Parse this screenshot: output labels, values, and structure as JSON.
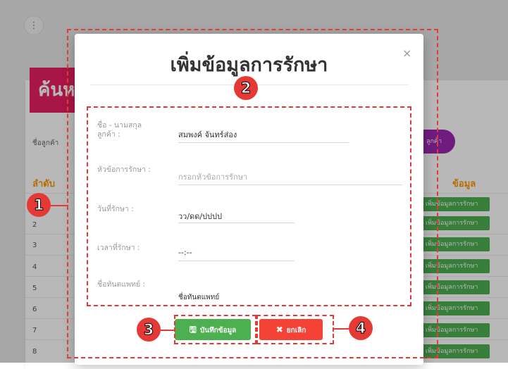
{
  "background": {
    "search_title": "ค้นห",
    "customer_label": "ชื่อลูกค้า",
    "customer_button": "ลูกค้า",
    "col_order": "ลำดับ",
    "col_add": "ข้อมูล",
    "rows": [
      "2",
      "3",
      "4",
      "5",
      "6",
      "7",
      "8"
    ],
    "row_action": "| เพิ่มข้อมูลการรักษา"
  },
  "modal": {
    "title": "เพิ่มข้อมูลการรักษา",
    "close": "×",
    "name_label": "ชื่อ - นามสกุล ลูกค้า :",
    "name_value": "สมพงค์ จันทร์ส่อง",
    "treatment_label": "หัวข้อการรักษา :",
    "treatment_placeholder": "กรอกหัวข้อการรักษา",
    "date_label": "วันที่รักษา :",
    "date_value": "วว/ดด/ปปปป",
    "time_label": "เวลาที่รักษา :",
    "time_value": "--:--",
    "doctor_label": "ชื่อทันตแพทย์ :",
    "doctor_value": "ชื่อทันตแพทย์",
    "save_label": "บันทึกข้อมูล",
    "cancel_label": "ยกเลิก"
  },
  "callouts": [
    "1",
    "2",
    "3",
    "4"
  ],
  "colors": {
    "accent_red": "#e53935",
    "save_green": "#4caf50",
    "cancel_red": "#f44336",
    "title_pink": "#e91e63",
    "customer_purple": "#9c27b0",
    "header_orange": "#ff9800"
  },
  "icons": {
    "menu": "more-vertical-icon",
    "save": "floppy-disk-icon",
    "cancel": "x-icon",
    "close": "close-icon"
  }
}
